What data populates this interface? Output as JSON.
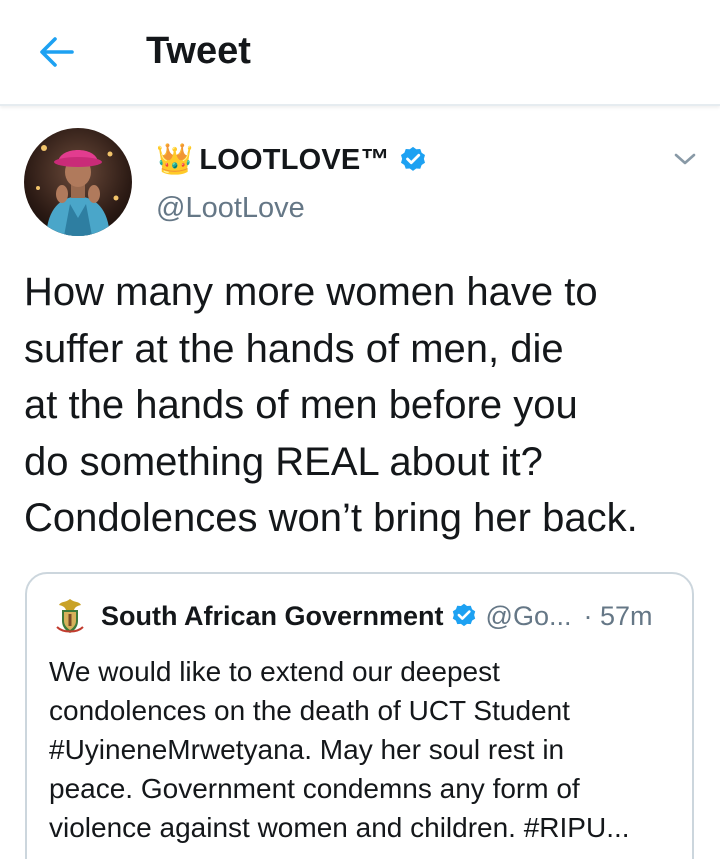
{
  "header": {
    "title": "Tweet",
    "back_icon": "arrow-left-icon"
  },
  "colors": {
    "accent": "#1da1f2",
    "text": "#14171a",
    "secondary_text": "#657786",
    "border": "#ccd6dd"
  },
  "tweet": {
    "author": {
      "name_prefix": "👑",
      "name": "LOOTLOVE™",
      "handle": "@LootLove",
      "verified": true
    },
    "text": "How many more women have to\nsuffer at the hands of men, die\nat the hands of men before you\ndo something REAL about it?\nCondolences won’t bring her back.",
    "menu_icon": "chevron-down-icon"
  },
  "quoted_tweet": {
    "author": {
      "name": "South African Government",
      "handle": "@Go...",
      "verified": true
    },
    "time": "· 57m",
    "text": "We would like to extend our deepest\ncondolences on the death of UCT Student\n#UyineneMrwetyana. May her soul rest in\npeace. Government condemns any form of\nviolence against women and children. #RIPU..."
  }
}
